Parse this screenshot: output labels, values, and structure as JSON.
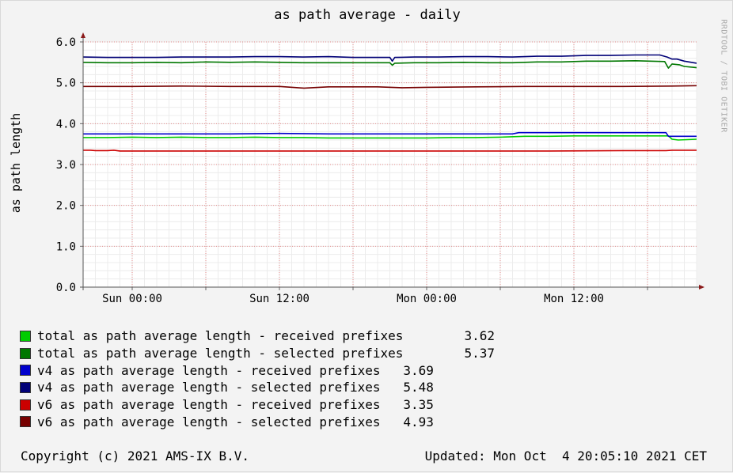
{
  "chart_data": {
    "type": "line",
    "title": "as path average - daily",
    "ylabel": "as path length",
    "xlabel": "",
    "watermark": "RRDTOOL / TOBI OETIKER",
    "ylim": [
      0,
      6
    ],
    "yticks": [
      "0.0",
      "1.0",
      "2.0",
      "3.0",
      "4.0",
      "5.0",
      "6.0"
    ],
    "x_tick_labels": [
      "Sun 00:00",
      "Sun 12:00",
      "Mon 00:00",
      "Mon 12:00"
    ],
    "grid": true,
    "series": [
      {
        "name": "total as path average length - received prefixes",
        "color": "#00cc00",
        "points": [
          [
            0,
            3.66
          ],
          [
            2,
            3.66
          ],
          [
            4,
            3.67
          ],
          [
            6,
            3.66
          ],
          [
            8,
            3.67
          ],
          [
            10,
            3.66
          ],
          [
            12,
            3.66
          ],
          [
            14,
            3.67
          ],
          [
            16,
            3.66
          ],
          [
            18,
            3.66
          ],
          [
            20,
            3.65
          ],
          [
            22,
            3.65
          ],
          [
            24,
            3.65
          ],
          [
            26,
            3.65
          ],
          [
            28,
            3.65
          ],
          [
            30,
            3.66
          ],
          [
            32,
            3.66
          ],
          [
            34,
            3.67
          ],
          [
            36,
            3.69
          ],
          [
            38,
            3.69
          ],
          [
            40,
            3.7
          ],
          [
            42,
            3.7
          ],
          [
            44,
            3.7
          ],
          [
            46,
            3.7
          ],
          [
            47.7,
            3.7
          ],
          [
            48,
            3.62
          ],
          [
            48.5,
            3.6
          ],
          [
            50,
            3.62
          ]
        ]
      },
      {
        "name": "total as path average length - selected prefixes",
        "color": "#007700",
        "points": [
          [
            0,
            5.5
          ],
          [
            2,
            5.49
          ],
          [
            4,
            5.49
          ],
          [
            6,
            5.5
          ],
          [
            8,
            5.49
          ],
          [
            10,
            5.51
          ],
          [
            12,
            5.5
          ],
          [
            14,
            5.51
          ],
          [
            16,
            5.5
          ],
          [
            18,
            5.49
          ],
          [
            20,
            5.49
          ],
          [
            22,
            5.49
          ],
          [
            24,
            5.49
          ],
          [
            25,
            5.49
          ],
          [
            25.2,
            5.43
          ],
          [
            25.4,
            5.48
          ],
          [
            27,
            5.49
          ],
          [
            29,
            5.49
          ],
          [
            31,
            5.5
          ],
          [
            33,
            5.49
          ],
          [
            35,
            5.49
          ],
          [
            37,
            5.51
          ],
          [
            39,
            5.51
          ],
          [
            41,
            5.53
          ],
          [
            43,
            5.53
          ],
          [
            45,
            5.54
          ],
          [
            47.4,
            5.52
          ],
          [
            47.7,
            5.36
          ],
          [
            48,
            5.46
          ],
          [
            48.6,
            5.44
          ],
          [
            49,
            5.4
          ],
          [
            50,
            5.37
          ]
        ]
      },
      {
        "name": "v4 as path average length - received prefixes",
        "color": "#0000cc",
        "points": [
          [
            0,
            3.75
          ],
          [
            4,
            3.75
          ],
          [
            8,
            3.75
          ],
          [
            12,
            3.75
          ],
          [
            16,
            3.76
          ],
          [
            20,
            3.75
          ],
          [
            24,
            3.75
          ],
          [
            28,
            3.75
          ],
          [
            32,
            3.75
          ],
          [
            35,
            3.75
          ],
          [
            35.5,
            3.78
          ],
          [
            40,
            3.78
          ],
          [
            44,
            3.78
          ],
          [
            47.5,
            3.78
          ],
          [
            47.7,
            3.69
          ],
          [
            50,
            3.69
          ]
        ]
      },
      {
        "name": "v4 as path average length - selected prefixes",
        "color": "#000077",
        "points": [
          [
            0,
            5.63
          ],
          [
            2,
            5.62
          ],
          [
            4,
            5.62
          ],
          [
            6,
            5.62
          ],
          [
            8,
            5.63
          ],
          [
            10,
            5.63
          ],
          [
            12,
            5.63
          ],
          [
            14,
            5.64
          ],
          [
            16,
            5.64
          ],
          [
            18,
            5.63
          ],
          [
            20,
            5.64
          ],
          [
            22,
            5.62
          ],
          [
            24,
            5.62
          ],
          [
            25,
            5.62
          ],
          [
            25.2,
            5.53
          ],
          [
            25.4,
            5.62
          ],
          [
            27,
            5.63
          ],
          [
            29,
            5.63
          ],
          [
            31,
            5.64
          ],
          [
            33,
            5.64
          ],
          [
            35,
            5.63
          ],
          [
            37,
            5.65
          ],
          [
            39,
            5.65
          ],
          [
            41,
            5.67
          ],
          [
            43,
            5.67
          ],
          [
            45,
            5.68
          ],
          [
            47,
            5.68
          ],
          [
            47.6,
            5.63
          ],
          [
            48,
            5.58
          ],
          [
            48.4,
            5.58
          ],
          [
            49,
            5.53
          ],
          [
            50,
            5.48
          ]
        ]
      },
      {
        "name": "v6 as path average length - received prefixes",
        "color": "#cc0000",
        "points": [
          [
            0,
            3.35
          ],
          [
            0.6,
            3.35
          ],
          [
            1,
            3.34
          ],
          [
            2,
            3.34
          ],
          [
            2.5,
            3.35
          ],
          [
            3,
            3.33
          ],
          [
            8,
            3.33
          ],
          [
            14,
            3.33
          ],
          [
            20,
            3.33
          ],
          [
            26,
            3.33
          ],
          [
            32,
            3.33
          ],
          [
            38,
            3.33
          ],
          [
            44,
            3.34
          ],
          [
            47.5,
            3.34
          ],
          [
            48,
            3.35
          ],
          [
            50,
            3.35
          ]
        ]
      },
      {
        "name": "v6 as path average length - selected prefixes",
        "color": "#770000",
        "points": [
          [
            0,
            4.91
          ],
          [
            4,
            4.91
          ],
          [
            8,
            4.92
          ],
          [
            12,
            4.91
          ],
          [
            16,
            4.91
          ],
          [
            18,
            4.87
          ],
          [
            20,
            4.9
          ],
          [
            24,
            4.9
          ],
          [
            26,
            4.88
          ],
          [
            28,
            4.89
          ],
          [
            32,
            4.9
          ],
          [
            36,
            4.91
          ],
          [
            40,
            4.91
          ],
          [
            44,
            4.91
          ],
          [
            48,
            4.92
          ],
          [
            50,
            4.93
          ]
        ]
      }
    ]
  },
  "legend": {
    "rows": [
      {
        "label": "total as path average length - received prefixes",
        "value": "        3.62",
        "color": "#00cc00"
      },
      {
        "label": "total as path average length - selected prefixes",
        "value": "        5.37",
        "color": "#007700"
      },
      {
        "label": "v4 as path average length - received prefixes",
        "value": "   3.69",
        "color": "#0000cc"
      },
      {
        "label": "v4 as path average length - selected prefixes",
        "value": "   5.48",
        "color": "#000077"
      },
      {
        "label": "v6 as path average length - received prefixes",
        "value": "   3.35",
        "color": "#cc0000"
      },
      {
        "label": "v6 as path average length - selected prefixes",
        "value": "   4.93",
        "color": "#770000"
      }
    ]
  },
  "footer": {
    "copyright": "Copyright (c) 2021 AMS-IX B.V.",
    "updated": "Updated: Mon Oct  4 20:05:10 2021 CET"
  }
}
